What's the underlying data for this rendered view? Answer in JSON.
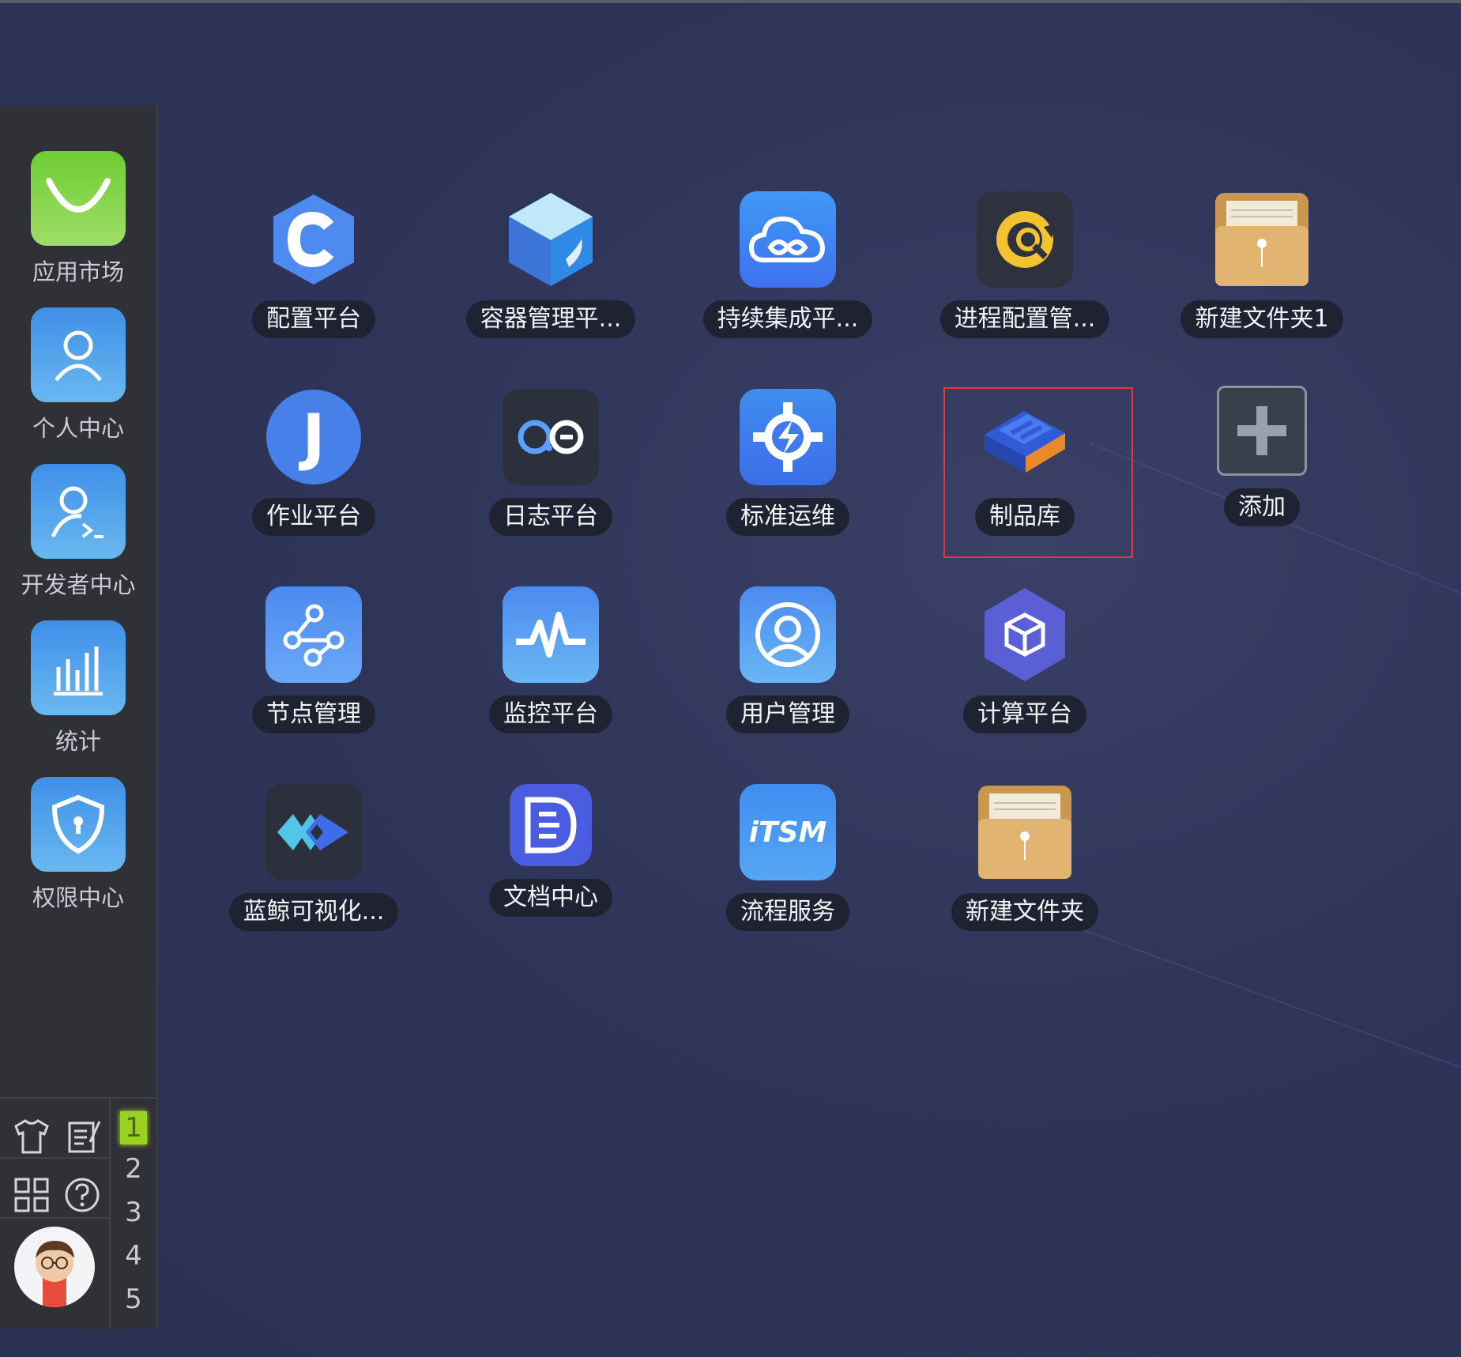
{
  "dock": {
    "items": [
      {
        "label": "应用市场",
        "icon": "shopping-bag-icon",
        "color": "#7ccf3c"
      },
      {
        "label": "个人中心",
        "icon": "user-icon",
        "color": "#4a9ee8"
      },
      {
        "label": "开发者中心",
        "icon": "developer-icon",
        "color": "#4a9ee8"
      },
      {
        "label": "统计",
        "icon": "bar-chart-icon",
        "color": "#4a9ee8"
      },
      {
        "label": "权限中心",
        "icon": "shield-icon",
        "color": "#4a9ee8"
      }
    ],
    "tools": [
      "shirt-icon",
      "notes-icon",
      "grid-icon",
      "help-icon"
    ],
    "pages": [
      "1",
      "2",
      "3",
      "4",
      "5"
    ]
  },
  "apps": [
    {
      "label": "配置平台",
      "icon": "config-hex-icon"
    },
    {
      "label": "容器管理平...",
      "icon": "container-cube-icon"
    },
    {
      "label": "持续集成平...",
      "icon": "ci-cloud-icon"
    },
    {
      "label": "进程配置管...",
      "icon": "process-gear-icon"
    },
    {
      "label": "新建文件夹1",
      "icon": "folder-icon"
    },
    {
      "label": "作业平台",
      "icon": "job-j-icon"
    },
    {
      "label": "日志平台",
      "icon": "log-icon"
    },
    {
      "label": "标准运维",
      "icon": "ops-gear-icon"
    },
    {
      "label": "制品库",
      "icon": "artifact-icon"
    },
    {
      "label": "添加",
      "icon": "add-icon"
    },
    {
      "label": "节点管理",
      "icon": "node-icon"
    },
    {
      "label": "监控平台",
      "icon": "monitor-pulse-icon"
    },
    {
      "label": "用户管理",
      "icon": "user-manage-icon"
    },
    {
      "label": "计算平台",
      "icon": "compute-cube-icon"
    },
    {
      "label": "蓝鲸可视化...",
      "icon": "visual-diamond-icon"
    },
    {
      "label": "文档中心",
      "icon": "document-icon"
    },
    {
      "label": "流程服务",
      "icon": "itsm-icon"
    },
    {
      "label": "新建文件夹",
      "icon": "folder-icon"
    }
  ],
  "itsm_text": "iTSM",
  "job_letter": "J"
}
